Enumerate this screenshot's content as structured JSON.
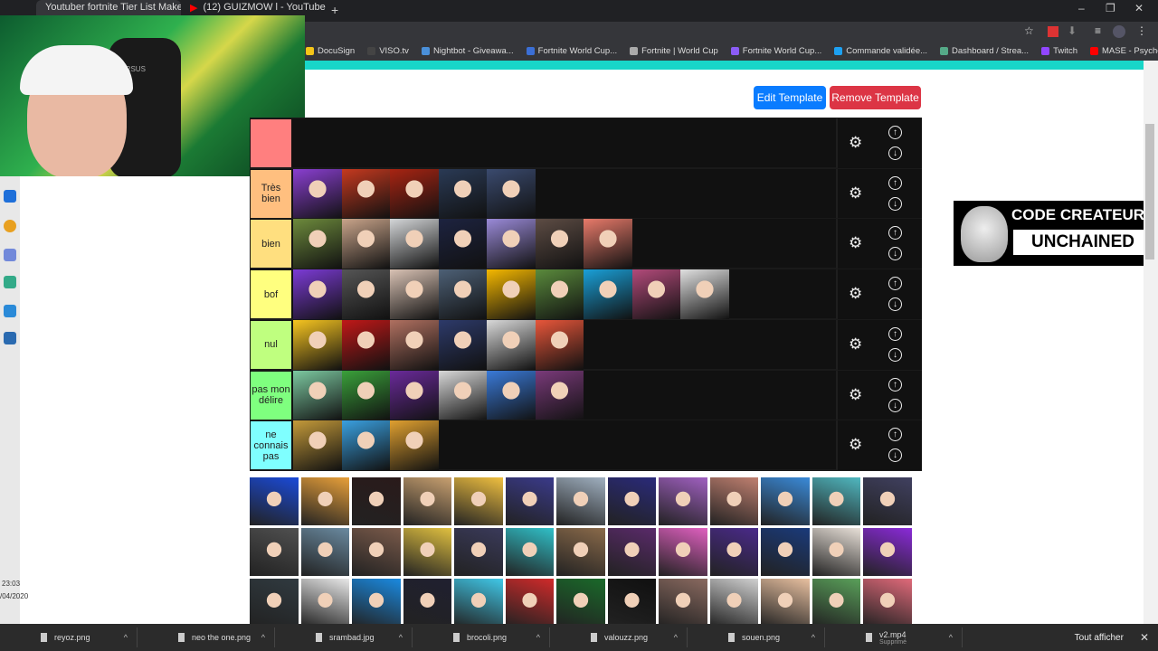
{
  "browser": {
    "tabs": [
      {
        "title": "Youtuber fortnite Tier List Make"
      },
      {
        "title": "(12) GUIZMOW l - YouTube"
      }
    ],
    "bookmarks": [
      {
        "label": "DocuSign",
        "color": "#f5c518"
      },
      {
        "label": "VISO.tv",
        "color": "#444"
      },
      {
        "label": "Nightbot - Giveawa...",
        "color": "#4a90d9"
      },
      {
        "label": "Fortnite World Cup...",
        "color": "#3b6fd6"
      },
      {
        "label": "Fortnite | World Cup",
        "color": "#aaa"
      },
      {
        "label": "Fortnite World Cup...",
        "color": "#8b5cf6"
      },
      {
        "label": "Commande validée...",
        "color": "#1da1f2"
      },
      {
        "label": "Dashboard / Strea...",
        "color": "#5a8"
      },
      {
        "label": "Twitch",
        "color": "#9146ff"
      },
      {
        "label": "MASE - Psycho! - Y...",
        "color": "#ff0000"
      }
    ]
  },
  "buttons": {
    "edit": "Edit Template",
    "remove": "Remove Template"
  },
  "tiers": [
    {
      "label": "",
      "color": "#ff7f7f",
      "items": []
    },
    {
      "label": "Très bien",
      "color": "#ffbf7f",
      "items": [
        "#8a3fd1",
        "#c5391f",
        "#a82412",
        "#2a3a55",
        "#3a4a6e"
      ]
    },
    {
      "label": "bien",
      "color": "#ffdf7f",
      "items": [
        "#6d8a3c",
        "#c9a48a",
        "#d4d6d8",
        "#1d2340",
        "#9a8ad8",
        "#5d4c44",
        "#e87a6a"
      ]
    },
    {
      "label": "bof",
      "color": "#ffff7f",
      "items": [
        "#7c3bd6",
        "#555",
        "#d9c2b4",
        "#4d6076",
        "#f5b800",
        "#5a8a3c",
        "#1aa0d8",
        "#b24a7a",
        "#e0e0e0"
      ]
    },
    {
      "label": "nul",
      "color": "#bfff7f",
      "items": [
        "#f7c520",
        "#c01818",
        "#b07060",
        "#2d3a6a",
        "#d9d9d9",
        "#e8563a"
      ]
    },
    {
      "label": "pas mon délire",
      "color": "#7fff7f",
      "items": [
        "#7cc8a0",
        "#3aa03a",
        "#6a2a9a",
        "#d8d8d8",
        "#3a7ad8",
        "#7a3a7a"
      ]
    },
    {
      "label": "ne connais pas",
      "color": "#7fffff",
      "items": [
        "#c49a3a",
        "#3aa0e0",
        "#e0a030"
      ]
    }
  ],
  "pool": [
    "#1a4ad8",
    "#e8a03a",
    "#2a1a1a",
    "#c8a070",
    "#f0c040",
    "#3a3a8a",
    "#a0b0c0",
    "#2a2a7a",
    "#a060c0",
    "#c08070",
    "#3a8ad8",
    "#50b8c0",
    "#404060",
    "#505050",
    "#6a8aa0",
    "#7a5a4a",
    "#e0c040",
    "#3a3a5a",
    "#30c0c8",
    "#8a6a4a",
    "#5a2a6a",
    "#e060c0",
    "#4a2a8a",
    "#1a3a7a",
    "#e8e0d8",
    "#8a2ad8",
    "#303a40",
    "#e8e8e8",
    "#1a8ae0",
    "#202030",
    "#40c8e8",
    "#d02a2a",
    "#1a6a2a",
    "#101010",
    "#8a6a60",
    "#d0d0d0",
    "#e8c0a0",
    "#5aa05a",
    "#e06a7a"
  ],
  "creator": {
    "line1": "CODE CREATEUR",
    "line2": "UNCHAINED"
  },
  "taskbar": {
    "time": "23:03",
    "date": "/04/2020"
  },
  "downloads": [
    {
      "name": "reyoz.png"
    },
    {
      "name": "neo the one.png"
    },
    {
      "name": "srambad.jpg"
    },
    {
      "name": "brocoli.png"
    },
    {
      "name": "valouzz.png"
    },
    {
      "name": "souen.png"
    },
    {
      "name": "v2.mp4",
      "sub": "Supprimé"
    }
  ],
  "downloads_show_all": "Tout afficher",
  "webcam": {
    "chair_text": "VERSUS"
  }
}
